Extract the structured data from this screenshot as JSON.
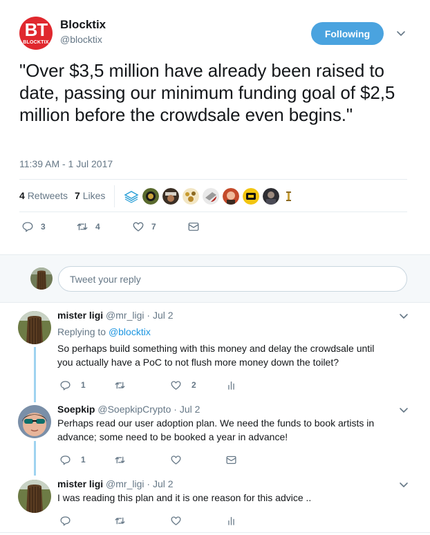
{
  "main_tweet": {
    "author": {
      "name": "Blocktix",
      "handle": "@blocktix",
      "logo_mark": "BT",
      "logo_text": "BLOCKTIX",
      "brand_color": "#e0282e"
    },
    "follow_button_label": "Following",
    "text": "\"Over $3,5 million have already been raised to date, passing our minimum funding goal of $2,5 million before the crowdsale even begins.\"",
    "timestamp": "11:39 AM - 1 Jul 2017",
    "stats": {
      "retweets_count": "4",
      "retweets_label": "Retweets",
      "likes_count": "7",
      "likes_label": "Likes"
    },
    "likers": [
      "liker-avatar",
      "liker-avatar",
      "liker-avatar",
      "liker-avatar",
      "liker-avatar",
      "liker-avatar",
      "liker-avatar",
      "liker-avatar",
      "liker-avatar"
    ],
    "actions": {
      "reply_count": "3",
      "retweet_count": "4",
      "like_count": "7"
    }
  },
  "reply_box": {
    "placeholder": "Tweet your reply"
  },
  "replies": [
    {
      "name": "mister ligi",
      "handle": "@mr_ligi",
      "date": "Jul 2",
      "replying_prefix": "Replying to",
      "replying_to": "@blocktix",
      "text": "So perhaps build something with this money and delay the crowdsale until you actually have a PoC to not flush more money down the toilet?",
      "reply_count": "1",
      "retweet_count": "",
      "like_count": "2",
      "last_icon": "analytics-icon"
    },
    {
      "name": "Soepkip",
      "handle": "@SoepkipCrypto",
      "date": "Jul 2",
      "text": "Perhaps read our user adoption plan. We need the funds to book artists in advance; some need to be booked a year in advance!",
      "reply_count": "1",
      "retweet_count": "",
      "like_count": "",
      "last_icon": "envelope-icon"
    },
    {
      "name": "mister ligi",
      "handle": "@mr_ligi",
      "date": "Jul 2",
      "text": "I was reading this plan and it is one reason for this advice ..",
      "reply_count": "",
      "retweet_count": "",
      "like_count": "",
      "last_icon": "analytics-icon"
    }
  ],
  "colors": {
    "accent": "#1b95e0",
    "follow_button": "#4aa3df",
    "thread_line": "#9fd3f0",
    "muted_text": "#657786"
  }
}
